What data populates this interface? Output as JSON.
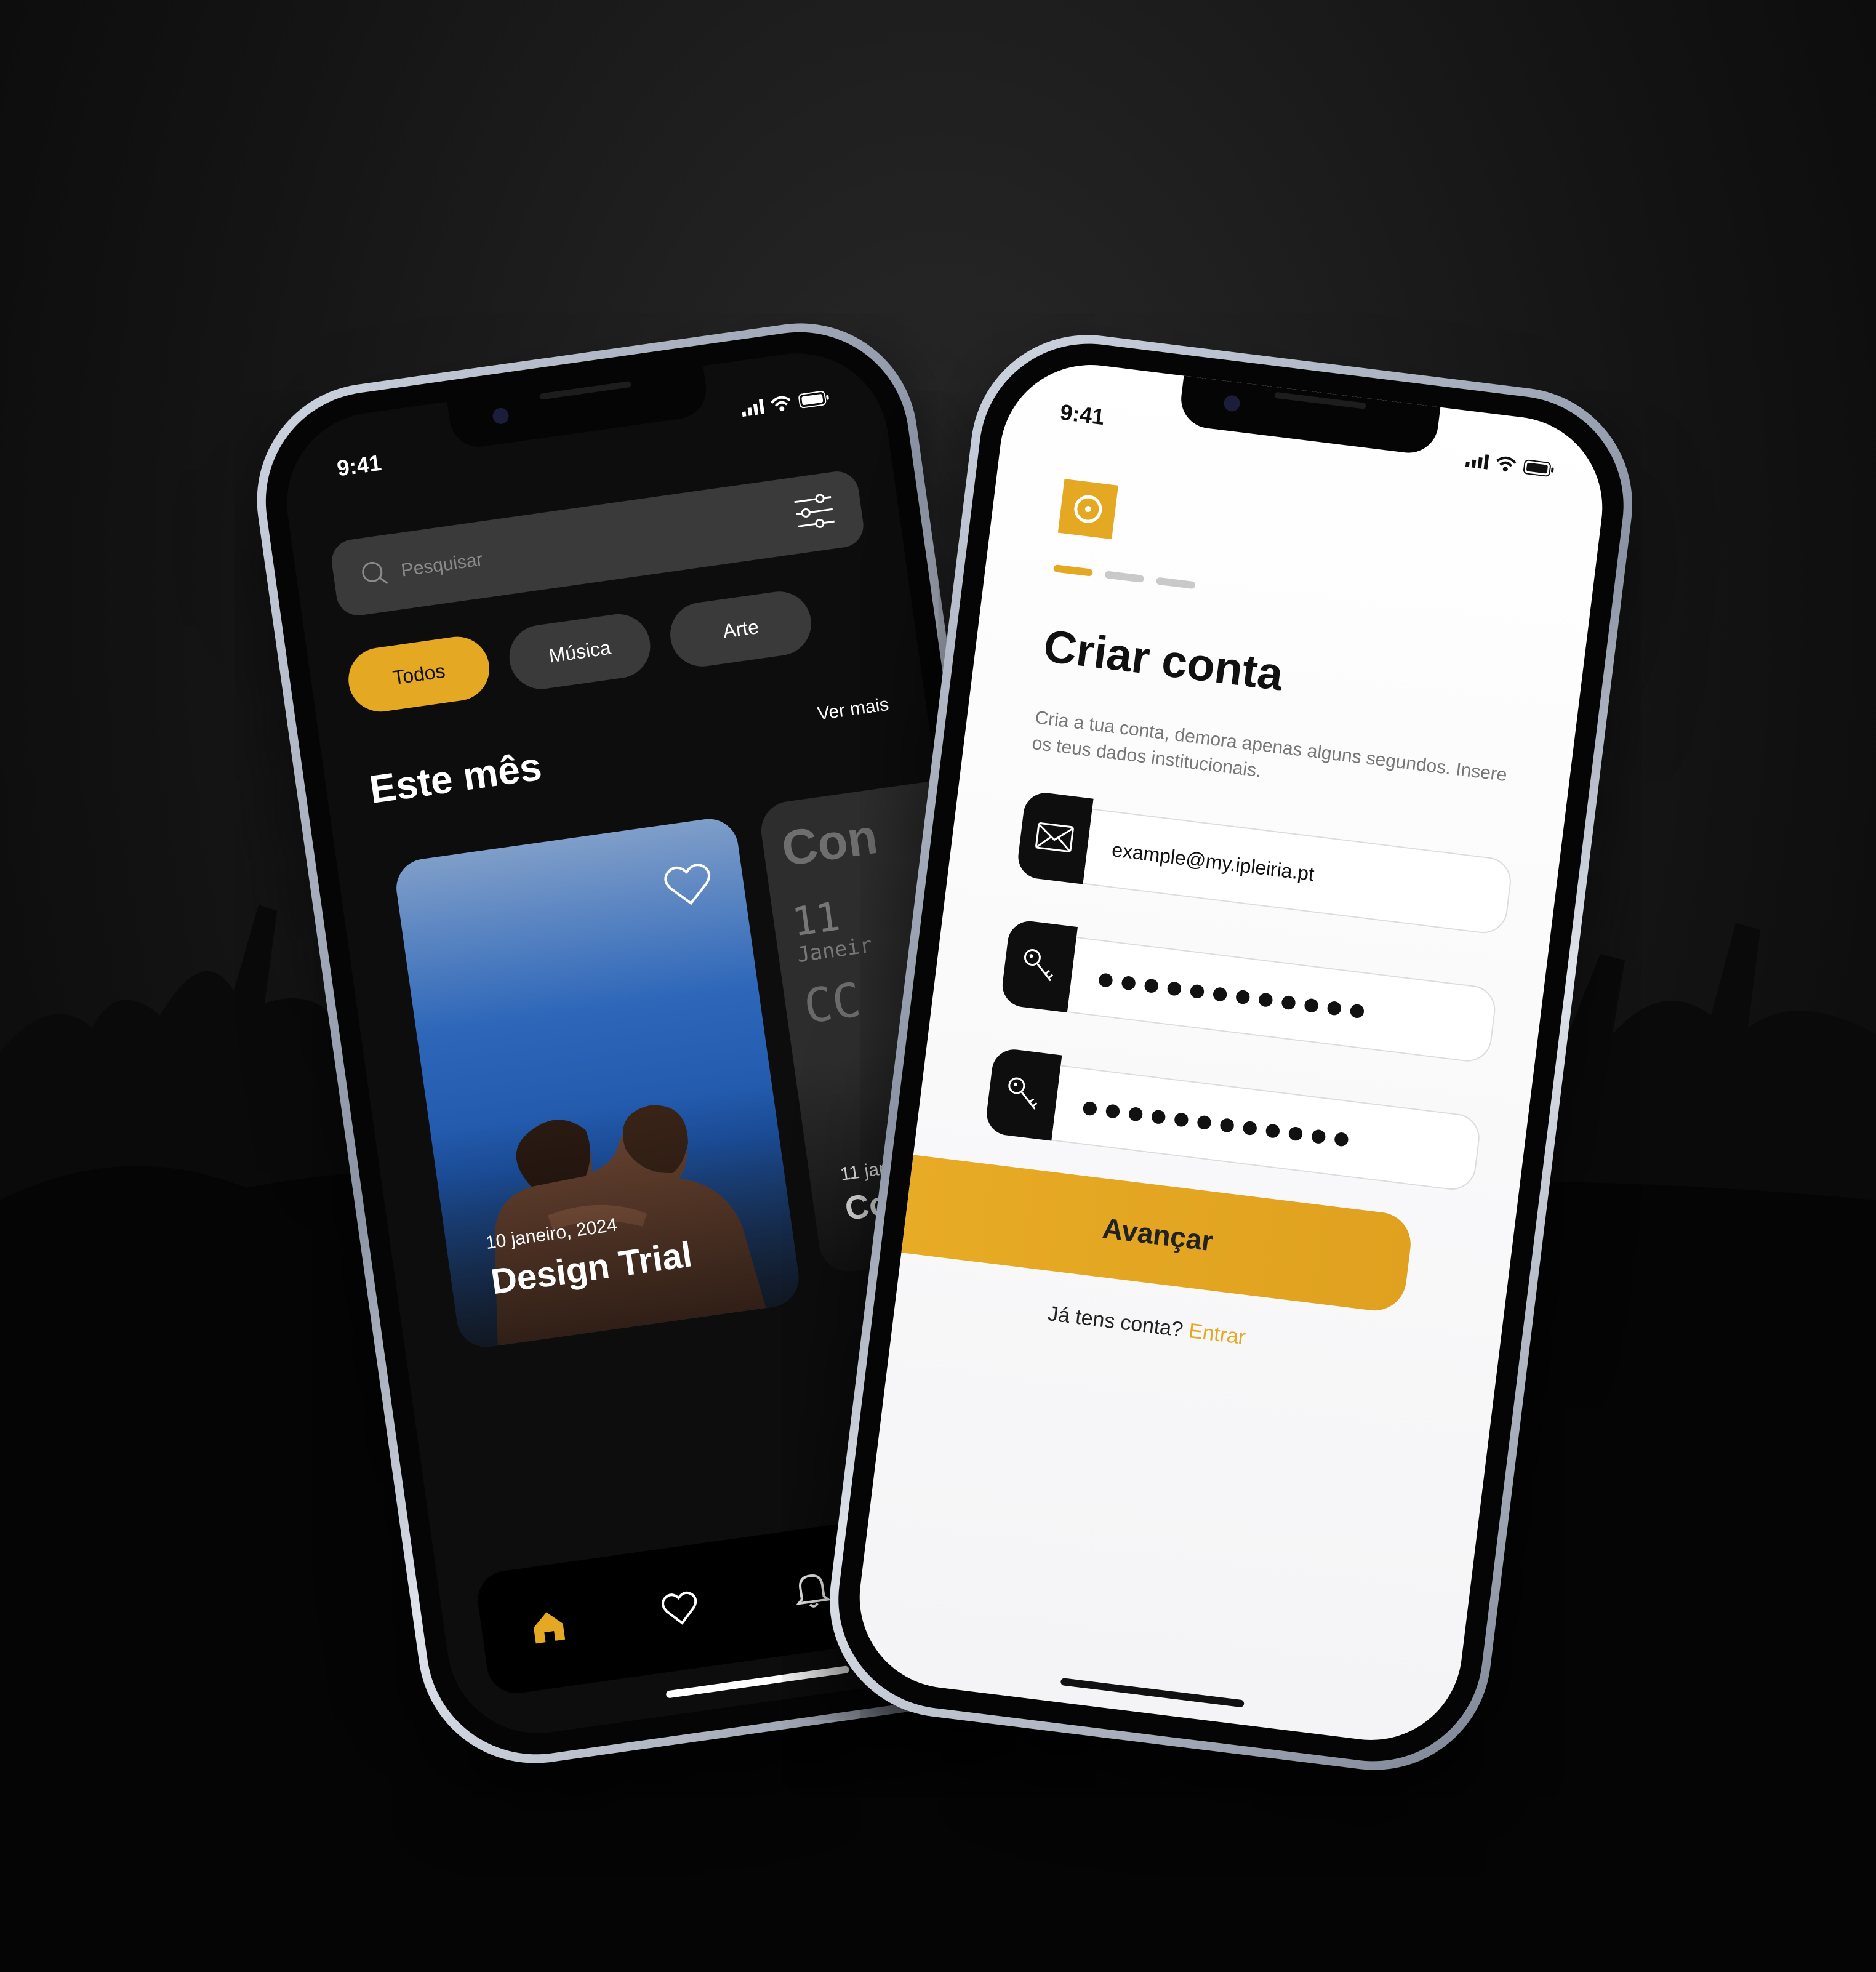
{
  "colors": {
    "accent": "#e5a823",
    "dark_bg": "#0d0d0d",
    "chip_bg": "#3a3a3a",
    "light_bg": "#ffffff"
  },
  "left_phone": {
    "status_time": "9:41",
    "search": {
      "placeholder": "Pesquisar",
      "icon": "search-icon",
      "filter_icon": "sliders-icon"
    },
    "chips": [
      {
        "label": "Todos",
        "active": true
      },
      {
        "label": "Música",
        "active": false
      },
      {
        "label": "Arte",
        "active": false
      }
    ],
    "section_title": "Este mês",
    "see_more": "Ver mais",
    "cards": [
      {
        "date": "10 janeiro, 2024",
        "title": "Design Trial",
        "favorite_icon": "heart-icon"
      },
      {
        "date": "11 janeir",
        "title": "Con",
        "poster_text": "Con",
        "poster_num": "11",
        "poster_month": "Janeir",
        "poster_cc": "CC"
      }
    ],
    "tabbar": [
      {
        "icon": "home-icon",
        "active": true
      },
      {
        "icon": "heart-icon",
        "active": false
      },
      {
        "icon": "bell-icon",
        "active": false
      },
      {
        "icon": "user-icon",
        "active": false
      }
    ]
  },
  "right_phone": {
    "status_time": "9:41",
    "progress_steps": 3,
    "progress_current": 1,
    "title": "Criar conta",
    "subtitle": "Cria a tua conta, demora apenas alguns segundos. Insere os teus dados institucionais.",
    "fields": [
      {
        "icon": "mail-icon",
        "value": "example@my.ipleiria.pt"
      },
      {
        "icon": "key-icon",
        "value": "●●●●●●●●●●●●"
      },
      {
        "icon": "key-icon",
        "value": "●●●●●●●●●●●●"
      }
    ],
    "submit_label": "Avançar",
    "login_prompt": "Já tens conta?",
    "login_link": "Entrar"
  }
}
